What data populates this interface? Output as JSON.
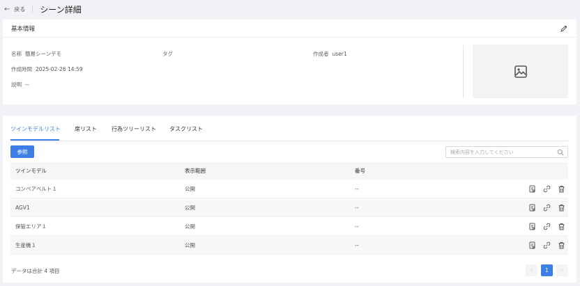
{
  "header": {
    "back_label": "戻る",
    "title": "シーン詳細"
  },
  "basic": {
    "section_title": "基本情報",
    "name_label": "名称",
    "name_value": "簡易シーンデモ",
    "tag_label": "タグ",
    "creator_label": "作成者",
    "creator_value": "user1",
    "created_label": "作成時間",
    "created_value": "2025-02-26 14:59",
    "desc_label": "説明",
    "desc_value": "--"
  },
  "tabs": [
    {
      "label": "ツインモデルリスト"
    },
    {
      "label": "席リスト"
    },
    {
      "label": "行為ツリーリスト"
    },
    {
      "label": "タスクリスト"
    }
  ],
  "toolbar": {
    "ref_button": "参照",
    "search_placeholder": "検索内容を入力してください"
  },
  "table": {
    "headers": [
      "ツインモデル",
      "表示範囲",
      "番号"
    ],
    "rows": [
      {
        "model": "コンベアベルト１",
        "scope": "公開",
        "num": "--"
      },
      {
        "model": "AGV1",
        "scope": "公開",
        "num": "--"
      },
      {
        "model": "保管エリア１",
        "scope": "公開",
        "num": "--"
      },
      {
        "model": "生産機１",
        "scope": "公開",
        "num": "--"
      }
    ]
  },
  "footer": {
    "total": "データは合計 4 項目",
    "prev": "‹",
    "page": "1",
    "next": "›"
  },
  "colors": {
    "accent": "#3d7fe6",
    "background": "#f0f2f5"
  },
  "icons": [
    "back-arrow-icon",
    "edit-icon",
    "image-placeholder-icon",
    "search-icon",
    "detail-icon",
    "link-icon",
    "delete-icon"
  ]
}
